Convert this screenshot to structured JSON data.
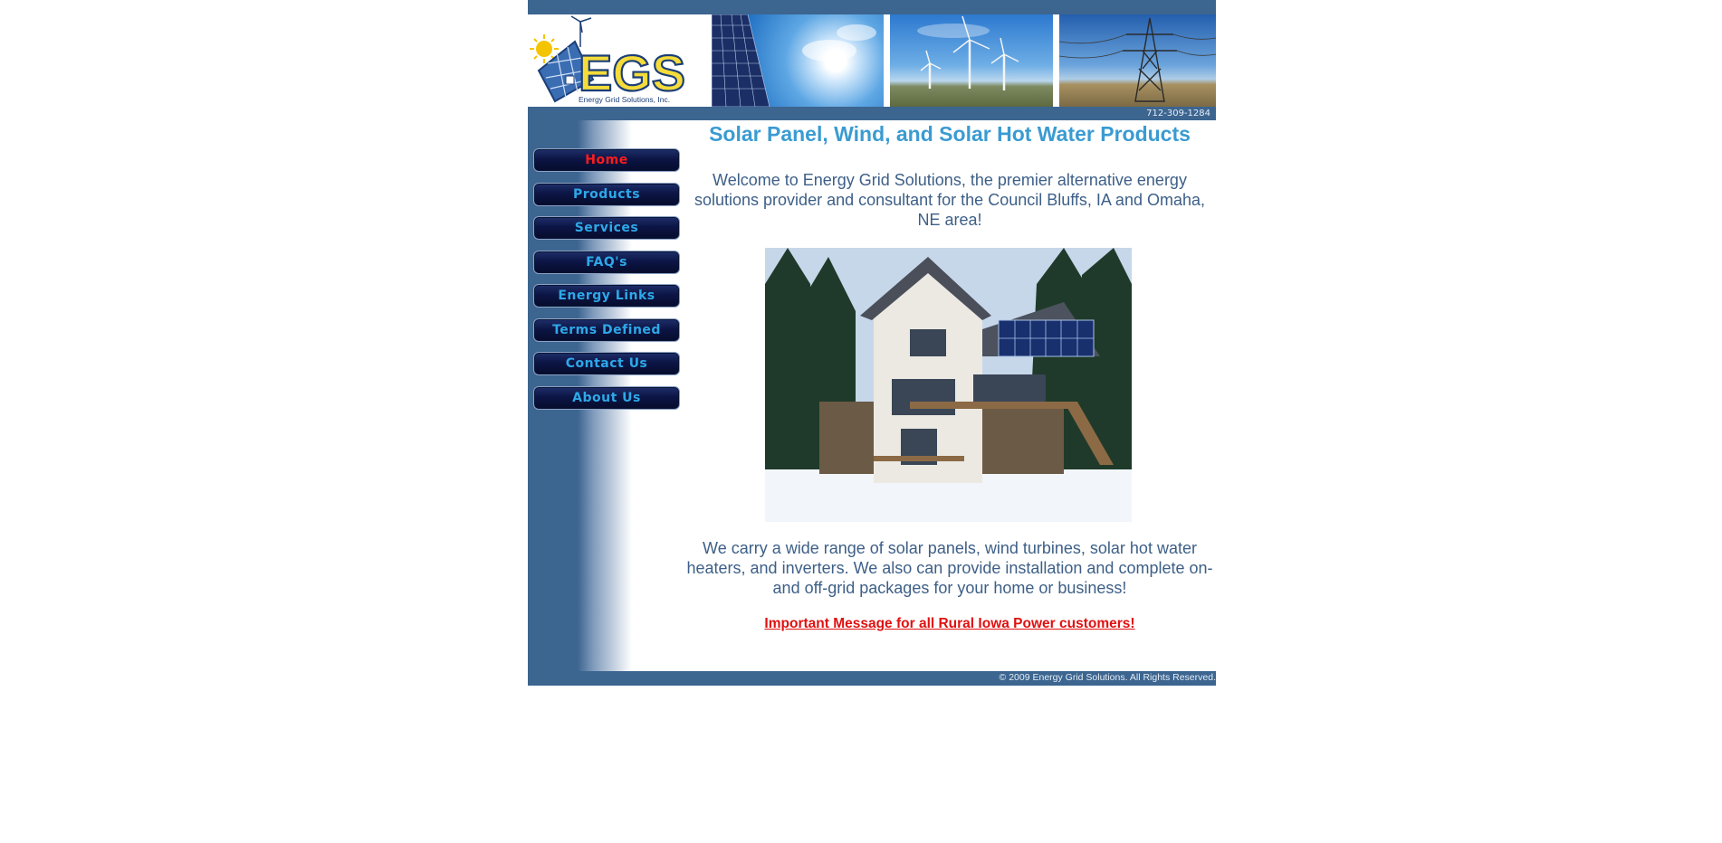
{
  "header": {
    "logo_text": "EGS",
    "logo_subtitle": "Energy Grid Solutions, Inc.",
    "phone": "712-309-1284"
  },
  "nav": {
    "items": [
      {
        "label": "Home",
        "active": true
      },
      {
        "label": "Products"
      },
      {
        "label": "Services"
      },
      {
        "label": "FAQ's"
      },
      {
        "label": "Energy Links"
      },
      {
        "label": "Terms Defined"
      },
      {
        "label": "Contact Us"
      },
      {
        "label": "About Us"
      }
    ]
  },
  "main": {
    "title": "Solar Panel, Wind, and Solar Hot Water Products",
    "intro": "Welcome to Energy Grid Solutions, the premier alternative energy solutions provider and consultant for the Council Bluffs, IA and Omaha, NE area!",
    "body": "We carry a wide range of solar panels, wind turbines, solar hot water heaters, and inverters. We also can provide installation and complete on- and off-grid packages for your home or business!",
    "link_text": "Important Message for all Rural Iowa Power customers!"
  },
  "footer": {
    "copyright": "© 2009 Energy Grid Solutions. All Rights Reserved."
  },
  "colors": {
    "site_blue": "#3c6590",
    "title_blue": "#3a9bd2",
    "text_blue": "#3d5f87",
    "link_red": "#e01010",
    "nav_text": "#2ea8e8",
    "nav_active": "#ff1c1c"
  }
}
